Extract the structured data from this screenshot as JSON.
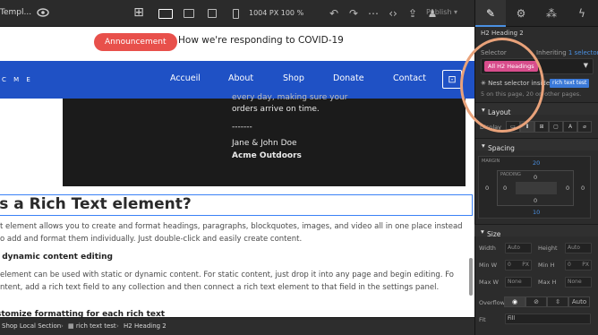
{
  "topbar": {
    "title": "Templ...",
    "size_readout": "1004 PX  100 %",
    "publish_label": "Publish ▾"
  },
  "canvas": {
    "announcement": {
      "pill": "Announcement",
      "text": "How we're responding to COVID-19"
    },
    "nav": {
      "brand": "C M E",
      "items": [
        "Accueil",
        "About",
        "Shop",
        "Donate",
        "Contact"
      ]
    },
    "dark_section": {
      "line1": "every day, making sure your",
      "line2": "orders arrive on time.",
      "divider": "-------",
      "signature1": "Jane & John Doe",
      "signature2": "Acme Outdoors"
    },
    "heading": "'s a Rich Text element?",
    "para1a": "t element allows you to create and format headings, paragraphs, blockquotes, images, and video all in one place instead",
    "para1b": "o add and format them individually. Just double-click and easily create content.",
    "sub1": "l dynamic content editing",
    "para2a": "element can be used with static or dynamic content. For static content, just drop it into any page and begin editing. Fo",
    "para2b": "ntent, add a rich text field to any collection and then connect a rich text element to that field in the settings panel.",
    "sub2": "stomize formatting for each rich text"
  },
  "breadcrumb": [
    "Shop Local Section",
    "rich text test",
    "Heading 2"
  ],
  "panel": {
    "element_label": "Heading 2",
    "selector_label": "Selector",
    "inheriting_label": "Inheriting",
    "inheriting_link": "1 selector",
    "selector_chip": "All H2 Headings",
    "nest_label": "Nest selector inside of",
    "nest_chip": "rich text test",
    "count_text": "5 on this page, 20 on other pages.",
    "layout_title": "Layout",
    "display_label": "Display",
    "spacing_title": "Spacing",
    "margin_label": "MARGIN",
    "padding_label": "PADDING",
    "margin_top": "20",
    "margin_bottom": "10",
    "margin_left": "0",
    "margin_right": "0",
    "padding_top": "0",
    "padding_bottom": "0",
    "padding_left": "0",
    "padding_right": "0",
    "size_title": "Size",
    "width_label": "Width",
    "height_label": "Height",
    "minw_label": "Min W",
    "minh_label": "Min H",
    "maxw_label": "Max W",
    "maxh_label": "Max H",
    "auto_value": "Auto",
    "zero_value": "0",
    "px_unit": "PX",
    "none_value": "None",
    "overflow_label": "Overflow",
    "overflow_auto": "Auto",
    "fit_label": "Fit",
    "fit_value": "Fill"
  },
  "colors": {
    "nav": "#1f51c5",
    "announcement": "#e8504b",
    "selector_chip": "#d84d8c",
    "highlight_circle": "#e9a27a"
  }
}
